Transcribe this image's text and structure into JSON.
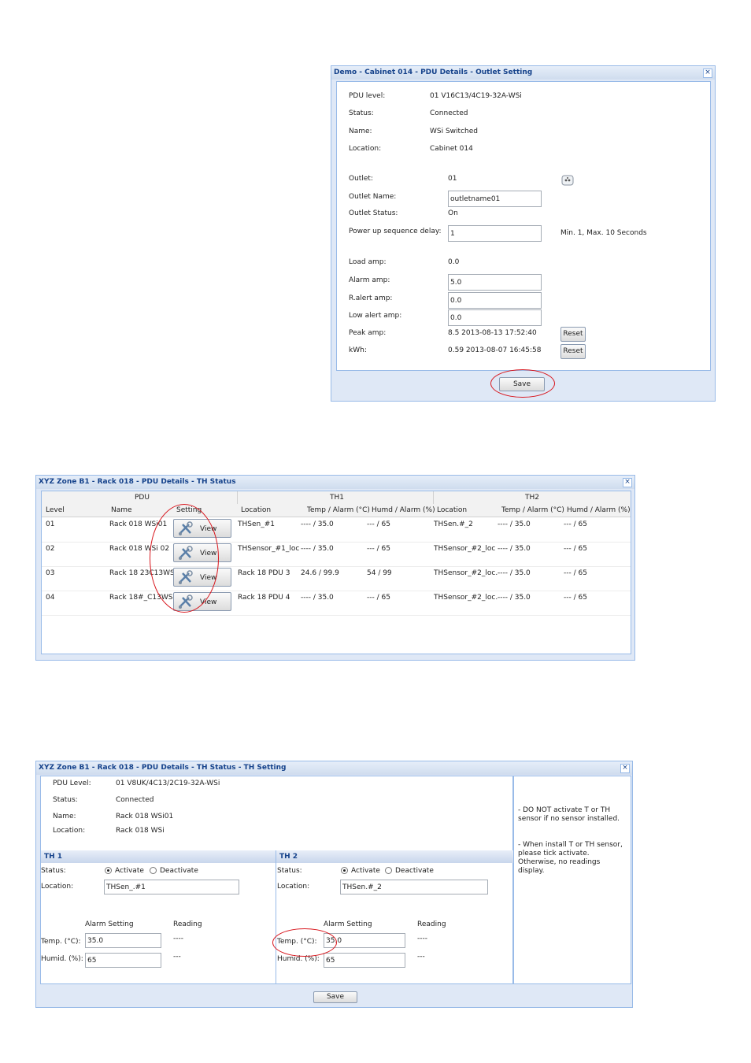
{
  "win1": {
    "title": "Demo - Cabinet 014 - PDU Details - Outlet Setting",
    "close": "×",
    "pdu_level_label": "PDU level:",
    "pdu_level": "01 V16C13/4C19-32A-WSi",
    "status_label": "Status:",
    "status": "Connected",
    "name_label": "Name:",
    "name": "WSi Switched",
    "location_label": "Location:",
    "location": "Cabinet 014",
    "outlet_label": "Outlet:",
    "outlet": "01",
    "outlet_icon": "power-socket-icon",
    "outlet_name_label": "Outlet Name:",
    "outlet_name": "outletname01",
    "outlet_status_label": "Outlet Status:",
    "outlet_status": "On",
    "power_delay_label": "Power up sequence delay:",
    "power_delay": "1",
    "power_delay_hint": "Min. 1, Max. 10 Seconds",
    "load_amp_label": "Load amp:",
    "load_amp": "0.0",
    "alarm_amp_label": "Alarm amp:",
    "alarm_amp": "5.0",
    "ralert_amp_label": "R.alert amp:",
    "ralert_amp": "0.0",
    "low_alert_label": "Low alert amp:",
    "low_alert": "0.0",
    "peak_amp_label": "Peak amp:",
    "peak_amp": "8.5 2013-08-13 17:52:40",
    "kwh_label": "kWh:",
    "kwh": "0.59 2013-08-07 16:45:58",
    "reset_label": "Reset",
    "save_label": "Save"
  },
  "win2": {
    "title": "XYZ Zone B1 - Rack 018 - PDU Details - TH Status",
    "close": "×",
    "groups": [
      "PDU",
      "TH1",
      "TH2"
    ],
    "headers": [
      "Level",
      "Name",
      "Setting",
      "Location",
      "Temp / Alarm (°C)",
      "Humd / Alarm (%)",
      "Location",
      "Temp / Alarm (°C)",
      "Humd / Alarm (%)"
    ],
    "view_label": "View",
    "rows": [
      {
        "level": "01",
        "name": "Rack 018 WSi01",
        "loc1": "THSen_#1",
        "temp1": "---- / 35.0",
        "humd1": "--- / 65",
        "loc2": "THSen.#_2",
        "temp2": "---- / 35.0",
        "humd2": "--- / 65"
      },
      {
        "level": "02",
        "name": "Rack 018 WSi 02",
        "loc1": "THSensor_#1_loc",
        "temp1": "---- / 35.0",
        "humd1": "--- / 65",
        "loc2": "THSensor_#2_loc",
        "temp2": "---- / 35.0",
        "humd2": "--- / 65"
      },
      {
        "level": "03",
        "name": "Rack 18 23C13WSi",
        "loc1": "Rack 18 PDU 3",
        "temp1": "24.6 / 99.9",
        "humd1": "54 / 99",
        "loc2": "THSensor_#2_loc.",
        "temp2": "---- / 35.0",
        "humd2": "--- / 65"
      },
      {
        "level": "04",
        "name": "Rack 18#_C13WSi",
        "loc1": "Rack 18 PDU 4",
        "temp1": "---- / 35.0",
        "humd1": "--- / 65",
        "loc2": "THSensor_#2_loc.",
        "temp2": "---- / 35.0",
        "humd2": "--- / 65"
      }
    ]
  },
  "win3": {
    "title": "XYZ Zone B1 - Rack 018 - PDU Details - TH Status - TH Setting",
    "close": "×",
    "pdu_level_label": "PDU Level:",
    "pdu_level": "01 V8UK/4C13/2C19-32A-WSi",
    "status_label": "Status:",
    "status": "Connected",
    "name_label": "Name:",
    "name": "Rack 018 WSi01",
    "location_label": "Location:",
    "location": "Rack 018 WSi",
    "note1": "- DO NOT activate T or TH sensor if no sensor installed.",
    "note2": "- When install T or TH sensor, please tick activate. Otherwise, no readings display.",
    "th1": {
      "header": "TH 1",
      "status_label": "Status:",
      "activate": "Activate",
      "deactivate": "Deactivate",
      "location_label": "Location:",
      "location": "THSen_.#1",
      "alarm_setting": "Alarm Setting",
      "reading": "Reading",
      "temp_label": "Temp. (°C):",
      "temp": "35.0",
      "temp_reading": "----",
      "humid_label": "Humid. (%):",
      "humid": "65",
      "humid_reading": "---"
    },
    "th2": {
      "header": "TH 2",
      "status_label": "Status:",
      "activate": "Activate",
      "deactivate": "Deactivate",
      "location_label": "Location:",
      "location": "THSen.#_2",
      "alarm_setting": "Alarm Setting",
      "reading": "Reading",
      "temp_label": "Temp. (°C):",
      "temp": "35.0",
      "temp_reading": "----",
      "humid_label": "Humid. (%):",
      "humid": "65",
      "humid_reading": "---"
    },
    "save_label": "Save"
  }
}
